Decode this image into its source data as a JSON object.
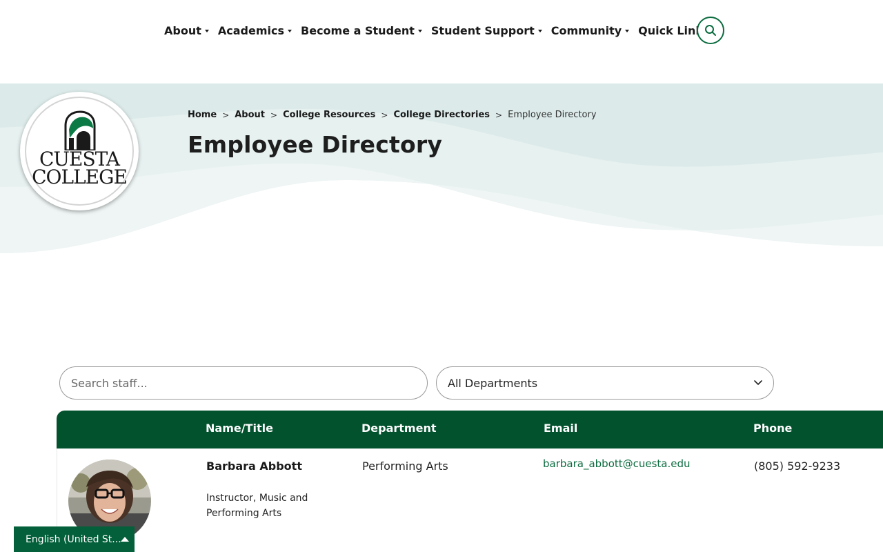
{
  "nav": {
    "items": [
      {
        "label": "About"
      },
      {
        "label": "Academics"
      },
      {
        "label": "Become a Student"
      },
      {
        "label": "Student Support"
      },
      {
        "label": "Community"
      },
      {
        "label": "Quick Links"
      }
    ],
    "search_icon": "search-icon"
  },
  "logo": {
    "line1": "CUESTA",
    "line2": "COLLEGE"
  },
  "breadcrumb": {
    "home": "Home",
    "about": "About",
    "resources": "College Resources",
    "directories": "College Directories",
    "current": "Employee Directory",
    "separator": ">"
  },
  "page": {
    "title": "Employee Directory"
  },
  "filters": {
    "search_placeholder": "Search staff...",
    "department_selected": "All Departments"
  },
  "table": {
    "columns": [
      "Name/Title",
      "Department",
      "Email",
      "Phone"
    ],
    "rows": [
      {
        "name": "Barbara Abbott",
        "title": "Instructor, Music and Performing Arts",
        "department": "Performing Arts",
        "email": "barbara_abbott@cuesta.edu",
        "phone": "(805) 592-9233"
      }
    ]
  },
  "language": {
    "label": "English (United St..."
  },
  "colors": {
    "brand_green": "#02522e",
    "accent_green": "#0b6b3f",
    "hero_bg": "#e6f0ef"
  }
}
